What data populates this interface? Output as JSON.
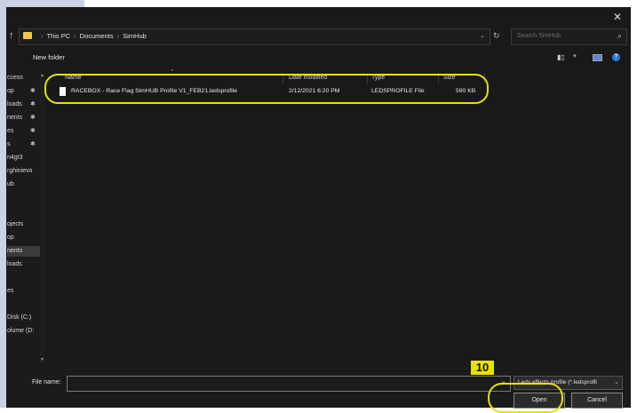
{
  "window": {
    "close_glyph": "✕"
  },
  "address": {
    "crumbs": [
      "This PC",
      "Documents",
      "SimHub"
    ],
    "separator": "›",
    "search_placeholder": "Search SimHub"
  },
  "toolbar": {
    "new_folder": "New folder"
  },
  "nav": {
    "items": [
      {
        "label": "ccess",
        "pinned": false
      },
      {
        "label": "op",
        "pinned": true
      },
      {
        "label": "loads",
        "pinned": true
      },
      {
        "label": "nents",
        "pinned": true
      },
      {
        "label": "es",
        "pinned": true
      },
      {
        "label": "s",
        "pinned": true
      },
      {
        "label": "n4gt3",
        "pinned": false
      },
      {
        "label": "rghinievo",
        "pinned": false
      },
      {
        "label": "ub",
        "pinned": false
      },
      {
        "label": "",
        "pinned": false
      },
      {
        "label": "",
        "pinned": false
      },
      {
        "label": "ojects",
        "pinned": false
      },
      {
        "label": "op",
        "pinned": false
      },
      {
        "label": "nents",
        "pinned": false,
        "selected": true
      },
      {
        "label": "loads",
        "pinned": false
      },
      {
        "label": "",
        "pinned": false
      },
      {
        "label": "es",
        "pinned": false
      },
      {
        "label": "",
        "pinned": false
      },
      {
        "label": "Disk (C:)",
        "pinned": false
      },
      {
        "label": "olume (D:",
        "pinned": false
      }
    ]
  },
  "columns": {
    "name": "Name",
    "date": "Date modified",
    "type": "Type",
    "size": "Size"
  },
  "files": [
    {
      "name": "RACEBOX - Race Flag SimHUB Profile V1_FEB21.ledsprofile",
      "date": "2/12/2021 6:20 PM",
      "type": "LEDSPROFILE File",
      "size": "590 KB"
    }
  ],
  "bottom": {
    "file_name_label": "File name:",
    "file_name_value": "",
    "filter": "Leds effects profile (*.ledsprofil",
    "open": "Open",
    "cancel": "Cancel"
  },
  "annotation": {
    "step": "10",
    "color": "#e8e200"
  }
}
